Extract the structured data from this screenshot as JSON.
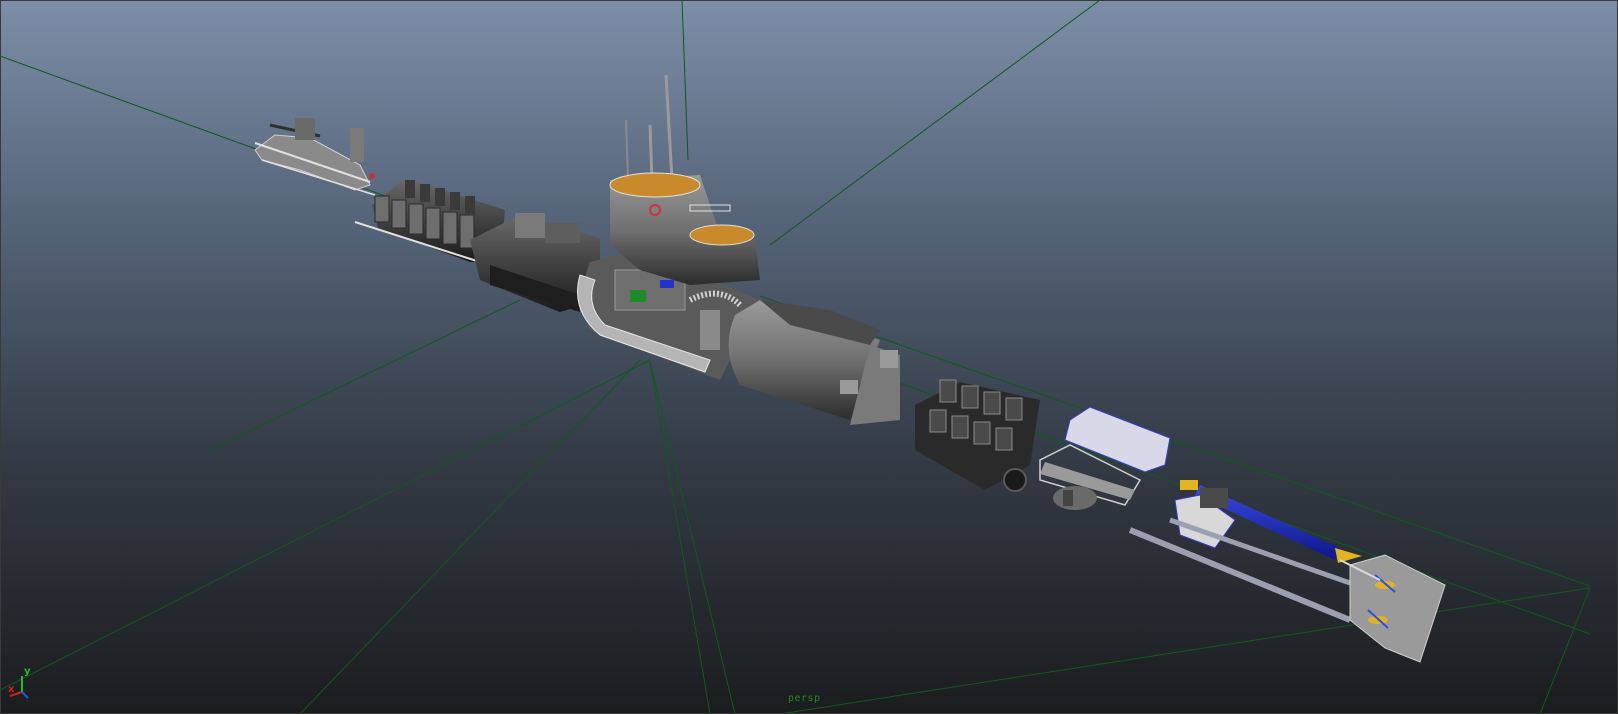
{
  "viewport": {
    "camera_name": "persp",
    "grid_color": "#0f5a1c",
    "background_top": "#7d8ea8",
    "background_bottom": "#1b1c1e"
  },
  "axis_gizmo": {
    "x_label": "x",
    "y_label": "y",
    "x_color": "#d42020",
    "y_color": "#22c022",
    "z_color": "#2a50e0"
  },
  "model": {
    "parts": [
      "deck-gun",
      "forward-torpedo-room",
      "forward-hull-section",
      "conning-tower",
      "control-room-section",
      "aft-hull-section",
      "diesel-engines",
      "electric-motors",
      "torpedo",
      "aft-torpedo-tubes",
      "stern-section"
    ],
    "accent_colors": {
      "hull": "#7a7a7a",
      "deck_wood": "#c88a2a",
      "torpedo_body": "#1d28b8",
      "torpedo_tip": "#e2b323"
    }
  }
}
